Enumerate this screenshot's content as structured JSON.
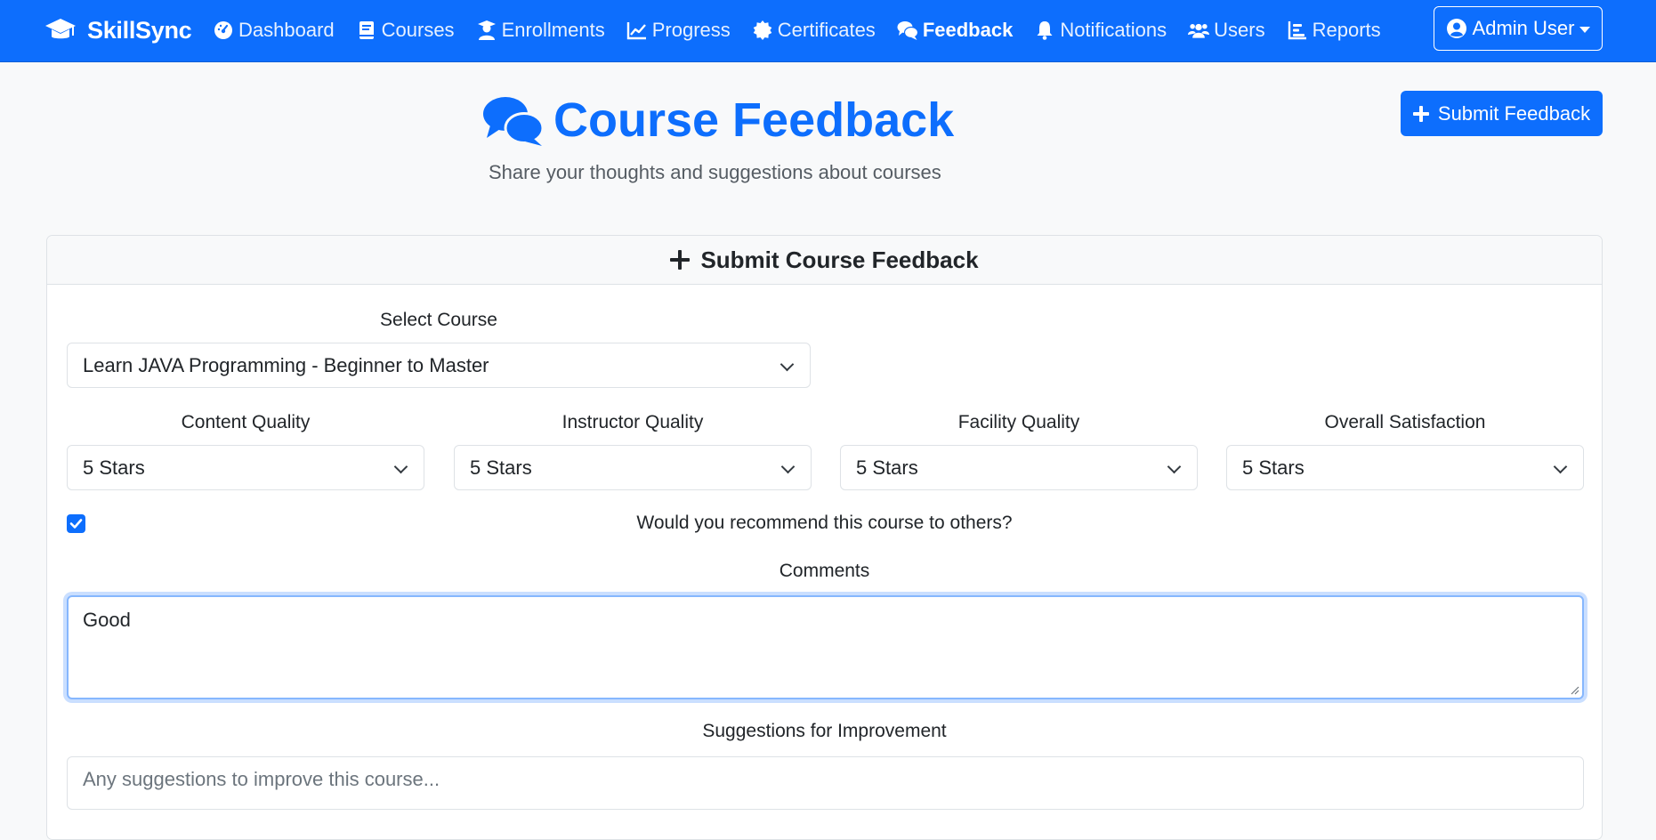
{
  "app": {
    "brand": "SkillSync",
    "nav": [
      {
        "label": "Dashboard",
        "icon": "dashboard-icon"
      },
      {
        "label": "Courses",
        "icon": "book-icon"
      },
      {
        "label": "Enrollments",
        "icon": "user-graduate-icon"
      },
      {
        "label": "Progress",
        "icon": "chart-line-icon"
      },
      {
        "label": "Certificates",
        "icon": "certificate-icon"
      },
      {
        "label": "Feedback",
        "icon": "comments-icon",
        "active": true
      },
      {
        "label": "Notifications",
        "icon": "bell-icon"
      },
      {
        "label": "Users",
        "icon": "users-icon"
      },
      {
        "label": "Reports",
        "icon": "reports-icon"
      }
    ],
    "user_menu": "Admin User"
  },
  "header": {
    "title": "Course Feedback",
    "subtitle": "Share your thoughts and suggestions about courses",
    "submit_button": "Submit Feedback"
  },
  "form": {
    "title": "Submit Course Feedback",
    "course_label": "Select Course",
    "course_value": "Learn JAVA Programming - Beginner to Master",
    "ratings": [
      {
        "label": "Content Quality",
        "value": "5 Stars"
      },
      {
        "label": "Instructor Quality",
        "value": "5 Stars"
      },
      {
        "label": "Facility Quality",
        "value": "5 Stars"
      },
      {
        "label": "Overall Satisfaction",
        "value": "5 Stars"
      }
    ],
    "recommend_label": "Would you recommend this course to others?",
    "recommend_checked": true,
    "comments_label": "Comments",
    "comments_value": "Good",
    "suggestions_label": "Suggestions for Improvement",
    "suggestions_placeholder": "Any suggestions to improve this course..."
  },
  "colors": {
    "primary": "#0d6efd",
    "page_bg": "#f8f9fa"
  }
}
